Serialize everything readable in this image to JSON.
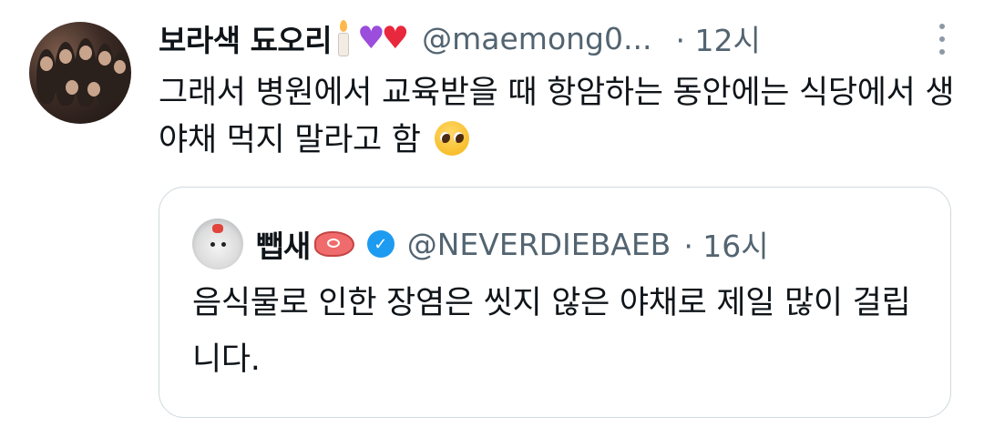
{
  "tweet": {
    "display_name": "보라색 됴오리",
    "badges": [
      "candle-icon",
      "purple-heart-icon",
      "red-heart-icon"
    ],
    "handle": "@maemong0...",
    "time": "· 12시",
    "text": "그래서 병원에서 교육받을 때 항암하는 동안에는 식당에서 생야채 먹지 말라고 함",
    "text_emoji": "pleading-face-icon"
  },
  "quoted_tweet": {
    "display_name": "뺍새",
    "name_emoji": "meat-icon",
    "verified": true,
    "handle": "@NEVERDIEBAEB",
    "time": "· 16시",
    "text": "음식물로 인한 장염은 씻지 않은 야채로 제일 많이 걸립니다."
  },
  "colors": {
    "text": "#0f1419",
    "secondary_text": "#536471",
    "border": "#cfd9de",
    "verified_blue": "#1d9bf0"
  }
}
